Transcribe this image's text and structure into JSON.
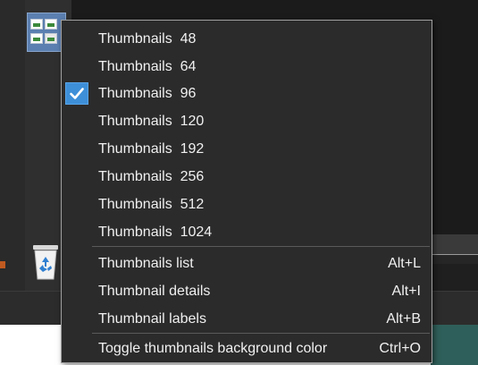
{
  "menu": {
    "thumbnail_sizes": [
      {
        "label": "Thumbnails  48",
        "checked": false
      },
      {
        "label": "Thumbnails  64",
        "checked": false
      },
      {
        "label": "Thumbnails  96",
        "checked": true
      },
      {
        "label": "Thumbnails  120",
        "checked": false
      },
      {
        "label": "Thumbnails  192",
        "checked": false
      },
      {
        "label": "Thumbnails  256",
        "checked": false
      },
      {
        "label": "Thumbnails  512",
        "checked": false
      },
      {
        "label": "Thumbnails  1024",
        "checked": false
      }
    ],
    "view_modes": [
      {
        "label": "Thumbnails list",
        "shortcut": "Alt+L"
      },
      {
        "label": "Thumbnail details",
        "shortcut": "Alt+I"
      },
      {
        "label": "Thumbnail labels",
        "shortcut": "Alt+B"
      }
    ],
    "toggle": {
      "label": "Toggle thumbnails background color",
      "shortcut": "Ctrl+O"
    }
  },
  "icons": {
    "checkmark": "checkmark-icon",
    "thumbnail_view": "thumbnail-view-icon",
    "recycle_bin": "recycle-bin-icon"
  },
  "colors": {
    "menu_background": "#2b2b2b",
    "check_highlight": "#3d8fd8",
    "menu_text": "#f0f0f0",
    "separator": "#5a5a5a"
  }
}
